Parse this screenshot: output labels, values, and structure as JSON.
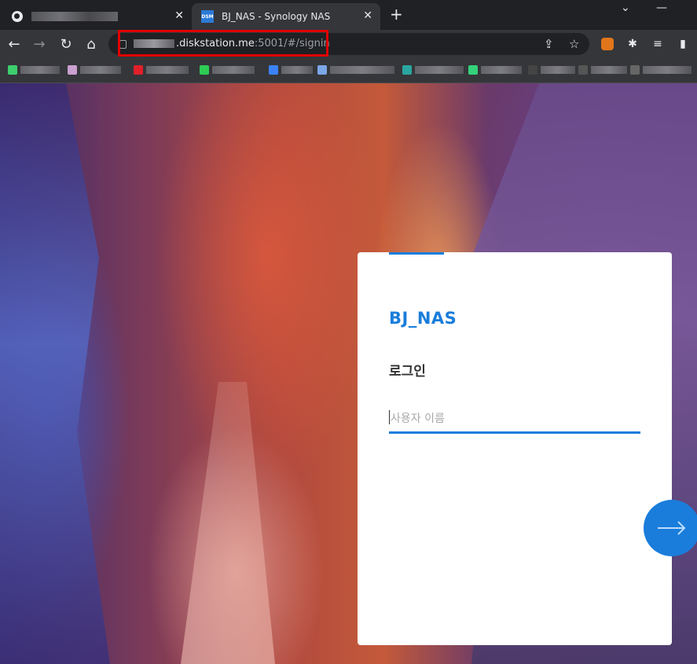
{
  "browser": {
    "tabs": [
      {
        "title": "",
        "active": false,
        "favicon": "globe-icon"
      },
      {
        "title": "BJ_NAS - Synology NAS",
        "active": true,
        "favicon": "DSM"
      }
    ],
    "address": {
      "host": ".diskstation.me",
      "rest": ":5001/#/signin"
    },
    "bookmarks_colors": [
      "#3ccf6e",
      "#c9a0d0",
      "#e0202a",
      "#2ecc55",
      "#3b82f6",
      "#7ba7e8",
      "#2aa7a0",
      "#34d27a",
      "#444444",
      "#555555",
      "#666666"
    ]
  },
  "login": {
    "brand": "BJ_NAS",
    "title": "로그인",
    "username_placeholder": "사용자 이름",
    "username_value": ""
  },
  "colors": {
    "accent": "#1a7ddb",
    "highlight_box": "#e00000"
  }
}
